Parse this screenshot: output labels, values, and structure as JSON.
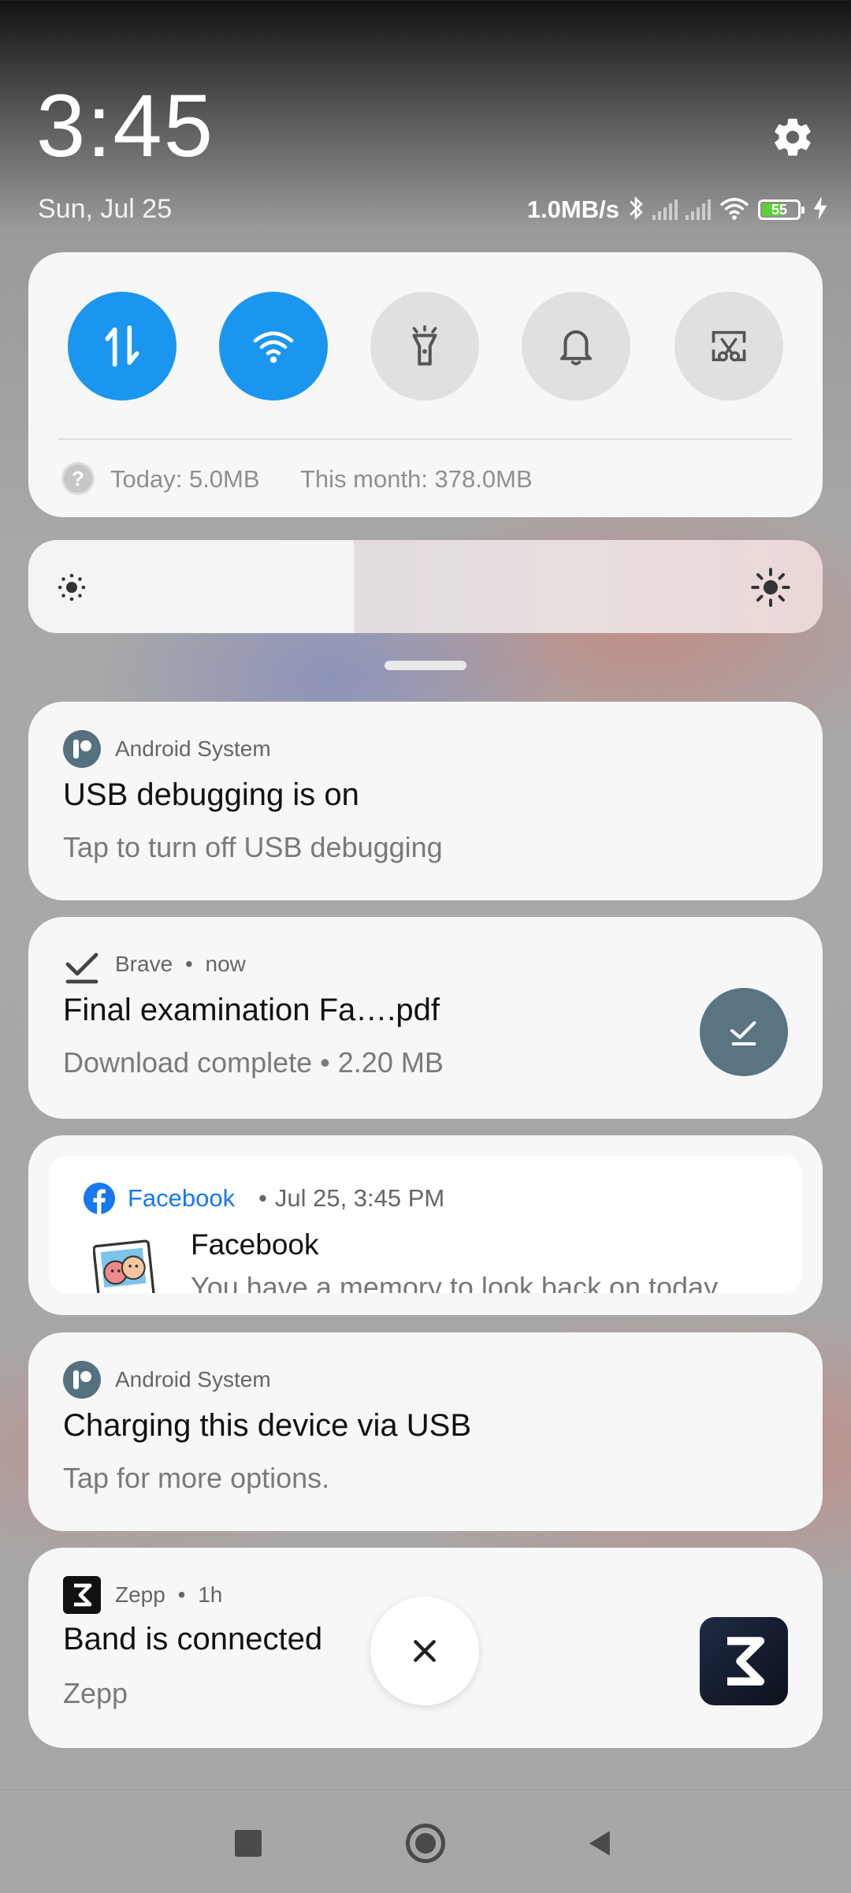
{
  "header": {
    "time": "3:45",
    "date": "Sun, Jul 25",
    "net_speed": "1.0MB/s",
    "battery_level": "55"
  },
  "quick_settings": {
    "toggles": [
      {
        "name": "mobile-data",
        "state": "on"
      },
      {
        "name": "wifi",
        "state": "on"
      },
      {
        "name": "flashlight",
        "state": "off"
      },
      {
        "name": "sound",
        "state": "off"
      },
      {
        "name": "screenshot",
        "state": "off"
      }
    ],
    "data_usage_today": "Today: 5.0MB",
    "data_usage_month": "This month: 378.0MB",
    "help_glyph": "?"
  },
  "brightness": {
    "level": 0.41
  },
  "notifications": [
    {
      "app": "Android System",
      "title": "USB debugging is on",
      "text": "Tap to turn off USB debugging"
    },
    {
      "app": "Brave",
      "time": "now",
      "title": "Final  examination Fa….pdf",
      "text": "Download complete • 2.20 MB"
    },
    {
      "app": "Facebook",
      "time": "Jul 25, 3:45 PM",
      "title": "Facebook",
      "text": "You have a memory to look back on today"
    },
    {
      "app": "Android System",
      "title": "Charging this device via USB",
      "text": "Tap for more options."
    },
    {
      "app": "Zepp",
      "time": "1h",
      "title": "Band is connected",
      "text": "Zepp"
    }
  ],
  "separators": {
    "dot": "•"
  },
  "colors": {
    "accent": "#1a96f0",
    "facebook": "#1877f2",
    "download_badge": "#5a7482",
    "zepp": "#111827"
  }
}
